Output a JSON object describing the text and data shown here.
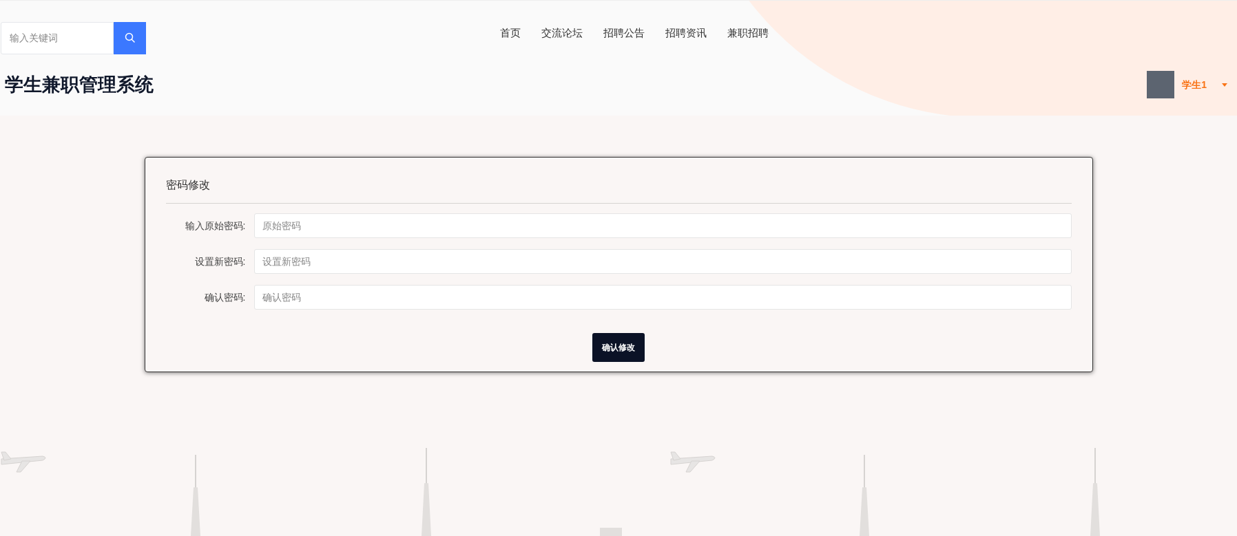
{
  "header": {
    "search": {
      "placeholder": "输入关键词"
    },
    "nav": [
      "首页",
      "交流论坛",
      "招聘公告",
      "招聘资讯",
      "兼职招聘"
    ],
    "site_title": "学生兼职管理系统",
    "user": {
      "name": "学生1"
    }
  },
  "form": {
    "title": "密码修改",
    "fields": [
      {
        "label": "输入原始密码:",
        "placeholder": "原始密码"
      },
      {
        "label": "设置新密码:",
        "placeholder": "设置新密码"
      },
      {
        "label": "确认密码:",
        "placeholder": "确认密码"
      }
    ],
    "submit": "确认修改"
  }
}
